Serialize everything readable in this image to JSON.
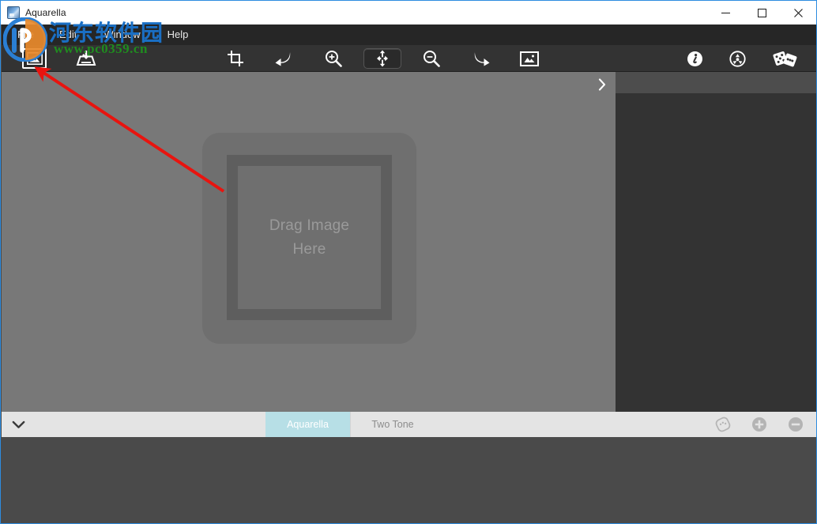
{
  "window": {
    "title": "Aquarella",
    "app_icon": "app-icon",
    "controls": [
      {
        "name": "minimize",
        "glyph": "minimize-icon"
      },
      {
        "name": "maximize",
        "glyph": "maximize-icon"
      },
      {
        "name": "close",
        "glyph": "close-icon"
      }
    ]
  },
  "menu": {
    "items": [
      {
        "label": "File"
      },
      {
        "label": "Edit"
      },
      {
        "label": "Window"
      },
      {
        "label": "Help"
      }
    ]
  },
  "toolbar": {
    "left_tools": [
      {
        "name": "open-image",
        "label": "Open Image",
        "icon": "image-icon",
        "selected": true
      },
      {
        "name": "save-image",
        "label": "Save Image",
        "icon": "save-icon",
        "selected": false
      }
    ],
    "center_tools": [
      {
        "name": "crop",
        "label": "Crop",
        "icon": "crop-icon",
        "selected": false
      },
      {
        "name": "undo",
        "label": "Undo",
        "icon": "undo-arrow-icon",
        "selected": false
      },
      {
        "name": "zoom-in",
        "label": "Zoom In",
        "icon": "magnifier-plus-icon",
        "selected": false
      },
      {
        "name": "move",
        "label": "Move",
        "icon": "move-arrows-icon",
        "selected": true
      },
      {
        "name": "zoom-out",
        "label": "Zoom Out",
        "icon": "magnifier-minus-icon",
        "selected": false
      },
      {
        "name": "redo",
        "label": "Redo",
        "icon": "redo-arrow-icon",
        "selected": false
      },
      {
        "name": "fit-image",
        "label": "Fit Image",
        "icon": "fit-image-icon",
        "selected": false
      }
    ],
    "right_tools": [
      {
        "name": "info",
        "label": "Info",
        "icon": "info-circle-icon",
        "selected": false
      },
      {
        "name": "effects",
        "label": "Effects",
        "icon": "recycle-circle-icon",
        "selected": false
      },
      {
        "name": "randomize",
        "label": "Randomize",
        "icon": "dice-icon",
        "selected": false
      }
    ]
  },
  "canvas": {
    "drop_zone_label": "Drag Image\nHere",
    "panel_toggle_icon": "chevron-right-icon"
  },
  "preset_bar": {
    "expand_icon": "chevron-down-icon",
    "tabs": [
      {
        "label": "Aquarella",
        "active": true
      },
      {
        "label": "Two Tone",
        "active": false
      }
    ],
    "actions": [
      {
        "name": "palette",
        "icon": "palette-circle-icon"
      },
      {
        "name": "add-preset",
        "icon": "plus-circle-icon"
      },
      {
        "name": "remove-preset",
        "icon": "minus-circle-icon"
      }
    ]
  },
  "watermark": {
    "site_name": "河东软件园",
    "url": "www.pc0359.cn"
  },
  "colors": {
    "title_bar": "#ffffff",
    "menu_bar": "#262626",
    "toolbar": "#333333",
    "canvas": "#787878",
    "right_panel": "#333333",
    "bottom_area": "#4a4a4a",
    "preset_bar": "#e4e4e4",
    "preset_active": "#b7dfe6",
    "window_border": "#2d8ce0",
    "annotation": "#e8140f"
  }
}
